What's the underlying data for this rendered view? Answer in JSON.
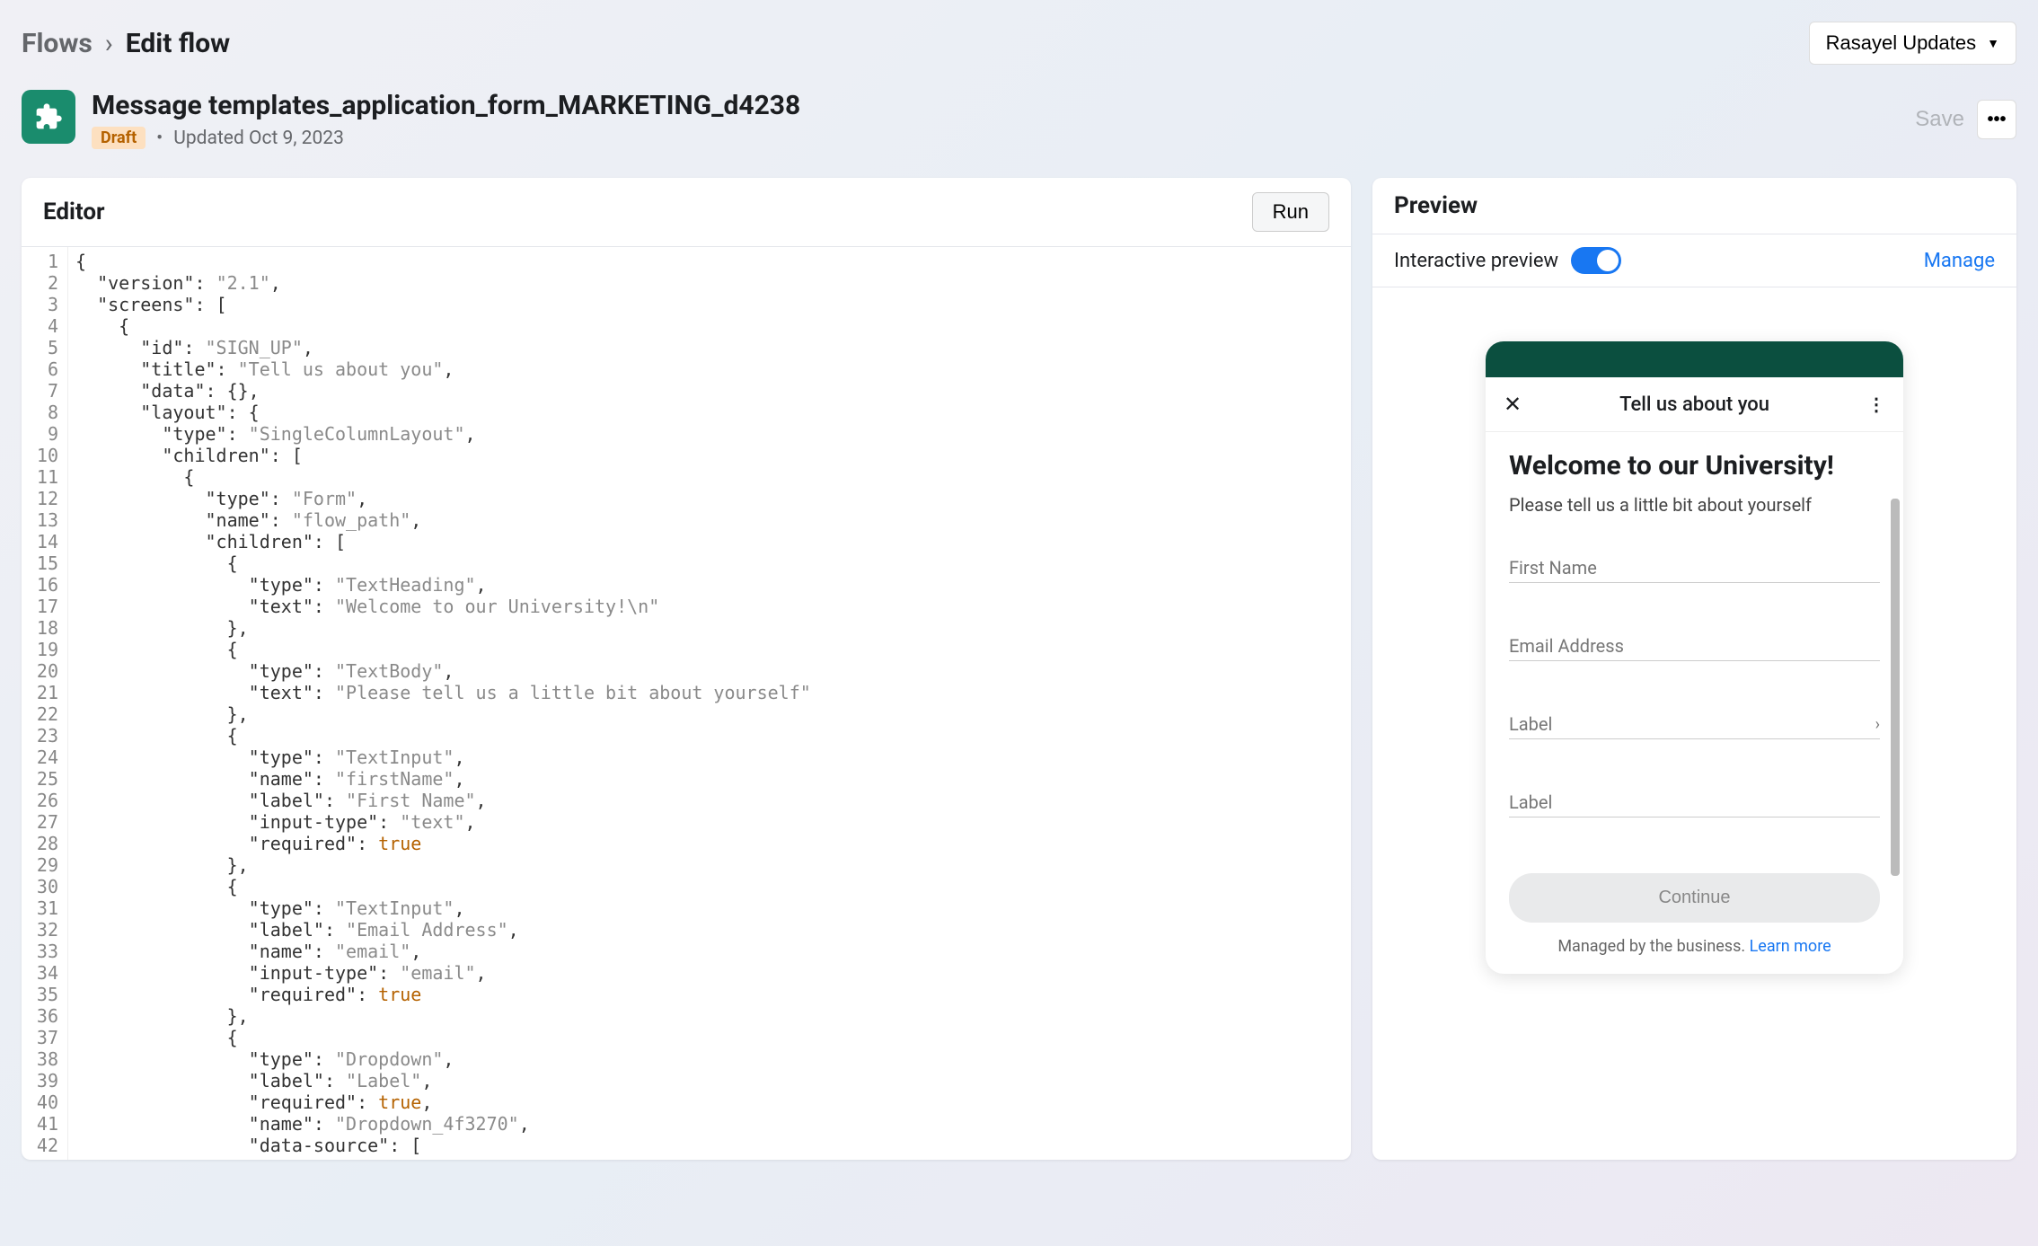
{
  "breadcrumb": {
    "flows": "Flows",
    "edit": "Edit flow"
  },
  "updates_button": "Rasayel Updates",
  "flow": {
    "title": "Message templates_application_form_MARKETING_d4238",
    "status": "Draft",
    "updated": "Updated Oct 9, 2023"
  },
  "actions": {
    "save": "Save"
  },
  "editor": {
    "title": "Editor",
    "run": "Run"
  },
  "code_lines": [
    {
      "n": 1,
      "ind": 0,
      "tokens": [
        [
          "p",
          "{"
        ]
      ]
    },
    {
      "n": 2,
      "ind": 1,
      "tokens": [
        [
          "k",
          "\"version\""
        ],
        [
          "p",
          ": "
        ],
        [
          "s",
          "\"2.1\""
        ],
        [
          "p",
          ","
        ]
      ]
    },
    {
      "n": 3,
      "ind": 1,
      "tokens": [
        [
          "k",
          "\"screens\""
        ],
        [
          "p",
          ": ["
        ]
      ]
    },
    {
      "n": 4,
      "ind": 2,
      "tokens": [
        [
          "p",
          "{"
        ]
      ]
    },
    {
      "n": 5,
      "ind": 3,
      "tokens": [
        [
          "k",
          "\"id\""
        ],
        [
          "p",
          ": "
        ],
        [
          "s",
          "\"SIGN_UP\""
        ],
        [
          "p",
          ","
        ]
      ]
    },
    {
      "n": 6,
      "ind": 3,
      "tokens": [
        [
          "k",
          "\"title\""
        ],
        [
          "p",
          ": "
        ],
        [
          "s",
          "\"Tell us about you\""
        ],
        [
          "p",
          ","
        ]
      ]
    },
    {
      "n": 7,
      "ind": 3,
      "tokens": [
        [
          "k",
          "\"data\""
        ],
        [
          "p",
          ": {},"
        ]
      ]
    },
    {
      "n": 8,
      "ind": 3,
      "tokens": [
        [
          "k",
          "\"layout\""
        ],
        [
          "p",
          ": {"
        ]
      ]
    },
    {
      "n": 9,
      "ind": 4,
      "tokens": [
        [
          "k",
          "\"type\""
        ],
        [
          "p",
          ": "
        ],
        [
          "s",
          "\"SingleColumnLayout\""
        ],
        [
          "p",
          ","
        ]
      ]
    },
    {
      "n": 10,
      "ind": 4,
      "tokens": [
        [
          "k",
          "\"children\""
        ],
        [
          "p",
          ": ["
        ]
      ]
    },
    {
      "n": 11,
      "ind": 5,
      "tokens": [
        [
          "p",
          "{"
        ]
      ]
    },
    {
      "n": 12,
      "ind": 6,
      "tokens": [
        [
          "k",
          "\"type\""
        ],
        [
          "p",
          ": "
        ],
        [
          "s",
          "\"Form\""
        ],
        [
          "p",
          ","
        ]
      ]
    },
    {
      "n": 13,
      "ind": 6,
      "tokens": [
        [
          "k",
          "\"name\""
        ],
        [
          "p",
          ": "
        ],
        [
          "s",
          "\"flow_path\""
        ],
        [
          "p",
          ","
        ]
      ]
    },
    {
      "n": 14,
      "ind": 6,
      "tokens": [
        [
          "k",
          "\"children\""
        ],
        [
          "p",
          ": ["
        ]
      ]
    },
    {
      "n": 15,
      "ind": 7,
      "tokens": [
        [
          "p",
          "{"
        ]
      ]
    },
    {
      "n": 16,
      "ind": 8,
      "tokens": [
        [
          "k",
          "\"type\""
        ],
        [
          "p",
          ": "
        ],
        [
          "s",
          "\"TextHeading\""
        ],
        [
          "p",
          ","
        ]
      ]
    },
    {
      "n": 17,
      "ind": 8,
      "tokens": [
        [
          "k",
          "\"text\""
        ],
        [
          "p",
          ": "
        ],
        [
          "s",
          "\"Welcome to our University!\\n\""
        ]
      ]
    },
    {
      "n": 18,
      "ind": 7,
      "tokens": [
        [
          "p",
          "},"
        ]
      ]
    },
    {
      "n": 19,
      "ind": 7,
      "tokens": [
        [
          "p",
          "{"
        ]
      ]
    },
    {
      "n": 20,
      "ind": 8,
      "tokens": [
        [
          "k",
          "\"type\""
        ],
        [
          "p",
          ": "
        ],
        [
          "s",
          "\"TextBody\""
        ],
        [
          "p",
          ","
        ]
      ]
    },
    {
      "n": 21,
      "ind": 8,
      "tokens": [
        [
          "k",
          "\"text\""
        ],
        [
          "p",
          ": "
        ],
        [
          "s",
          "\"Please tell us a little bit about yourself\""
        ]
      ]
    },
    {
      "n": 22,
      "ind": 7,
      "tokens": [
        [
          "p",
          "},"
        ]
      ]
    },
    {
      "n": 23,
      "ind": 7,
      "tokens": [
        [
          "p",
          "{"
        ]
      ]
    },
    {
      "n": 24,
      "ind": 8,
      "tokens": [
        [
          "k",
          "\"type\""
        ],
        [
          "p",
          ": "
        ],
        [
          "s",
          "\"TextInput\""
        ],
        [
          "p",
          ","
        ]
      ]
    },
    {
      "n": 25,
      "ind": 8,
      "tokens": [
        [
          "k",
          "\"name\""
        ],
        [
          "p",
          ": "
        ],
        [
          "s",
          "\"firstName\""
        ],
        [
          "p",
          ","
        ]
      ]
    },
    {
      "n": 26,
      "ind": 8,
      "tokens": [
        [
          "k",
          "\"label\""
        ],
        [
          "p",
          ": "
        ],
        [
          "s",
          "\"First Name\""
        ],
        [
          "p",
          ","
        ]
      ]
    },
    {
      "n": 27,
      "ind": 8,
      "tokens": [
        [
          "k",
          "\"input-type\""
        ],
        [
          "p",
          ": "
        ],
        [
          "s",
          "\"text\""
        ],
        [
          "p",
          ","
        ]
      ]
    },
    {
      "n": 28,
      "ind": 8,
      "tokens": [
        [
          "k",
          "\"required\""
        ],
        [
          "p",
          ": "
        ],
        [
          "b",
          "true"
        ]
      ]
    },
    {
      "n": 29,
      "ind": 7,
      "tokens": [
        [
          "p",
          "},"
        ]
      ]
    },
    {
      "n": 30,
      "ind": 7,
      "tokens": [
        [
          "p",
          "{"
        ]
      ]
    },
    {
      "n": 31,
      "ind": 8,
      "tokens": [
        [
          "k",
          "\"type\""
        ],
        [
          "p",
          ": "
        ],
        [
          "s",
          "\"TextInput\""
        ],
        [
          "p",
          ","
        ]
      ]
    },
    {
      "n": 32,
      "ind": 8,
      "tokens": [
        [
          "k",
          "\"label\""
        ],
        [
          "p",
          ": "
        ],
        [
          "s",
          "\"Email Address\""
        ],
        [
          "p",
          ","
        ]
      ]
    },
    {
      "n": 33,
      "ind": 8,
      "tokens": [
        [
          "k",
          "\"name\""
        ],
        [
          "p",
          ": "
        ],
        [
          "s",
          "\"email\""
        ],
        [
          "p",
          ","
        ]
      ]
    },
    {
      "n": 34,
      "ind": 8,
      "tokens": [
        [
          "k",
          "\"input-type\""
        ],
        [
          "p",
          ": "
        ],
        [
          "s",
          "\"email\""
        ],
        [
          "p",
          ","
        ]
      ]
    },
    {
      "n": 35,
      "ind": 8,
      "tokens": [
        [
          "k",
          "\"required\""
        ],
        [
          "p",
          ": "
        ],
        [
          "b",
          "true"
        ]
      ]
    },
    {
      "n": 36,
      "ind": 7,
      "tokens": [
        [
          "p",
          "},"
        ]
      ]
    },
    {
      "n": 37,
      "ind": 7,
      "tokens": [
        [
          "p",
          "{"
        ]
      ]
    },
    {
      "n": 38,
      "ind": 8,
      "tokens": [
        [
          "k",
          "\"type\""
        ],
        [
          "p",
          ": "
        ],
        [
          "s",
          "\"Dropdown\""
        ],
        [
          "p",
          ","
        ]
      ]
    },
    {
      "n": 39,
      "ind": 8,
      "tokens": [
        [
          "k",
          "\"label\""
        ],
        [
          "p",
          ": "
        ],
        [
          "s",
          "\"Label\""
        ],
        [
          "p",
          ","
        ]
      ]
    },
    {
      "n": 40,
      "ind": 8,
      "tokens": [
        [
          "k",
          "\"required\""
        ],
        [
          "p",
          ": "
        ],
        [
          "b",
          "true"
        ],
        [
          "p",
          ","
        ]
      ]
    },
    {
      "n": 41,
      "ind": 8,
      "tokens": [
        [
          "k",
          "\"name\""
        ],
        [
          "p",
          ": "
        ],
        [
          "s",
          "\"Dropdown_4f3270\""
        ],
        [
          "p",
          ","
        ]
      ]
    },
    {
      "n": 42,
      "ind": 8,
      "tokens": [
        [
          "k",
          "\"data-source\""
        ],
        [
          "p",
          ": ["
        ]
      ]
    }
  ],
  "preview": {
    "title": "Preview",
    "interactive": "Interactive preview",
    "manage": "Manage",
    "phone": {
      "header": "Tell us about you",
      "heading": "Welcome to our University!",
      "body": "Please tell us a little bit about yourself",
      "fields": {
        "first_name": "First Name",
        "email": "Email Address",
        "label1": "Label",
        "label2": "Label"
      },
      "continue": "Continue",
      "managed": "Managed by the business.",
      "learn_more": "Learn more"
    }
  }
}
